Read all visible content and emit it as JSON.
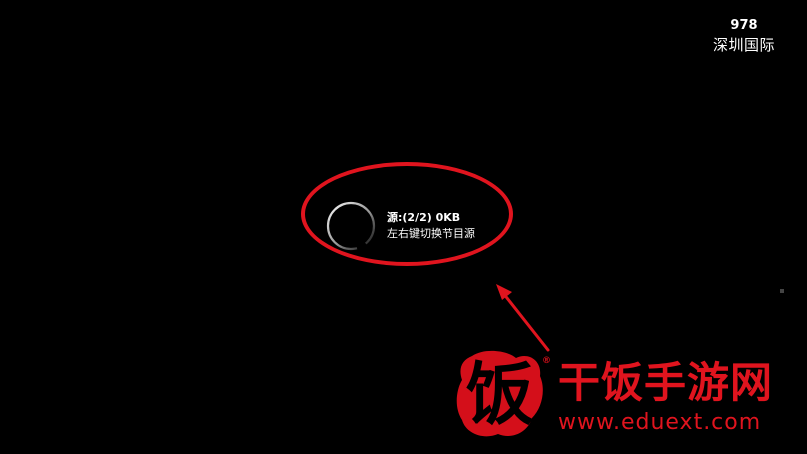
{
  "channel": {
    "number": "978",
    "name": "深圳国际"
  },
  "loading": {
    "source_status": "源:(2/2)  0KB",
    "hint": "左右键切换节目源",
    "spinner_icon": "loading-spinner-icon"
  },
  "watermark": {
    "logo_char": "饭",
    "registered_mark": "®",
    "site_name": "干饭手游网",
    "site_url": "www.eduext.com"
  },
  "colors": {
    "background": "#000000",
    "text": "#ffffff",
    "annotation_red": "#e0141e",
    "watermark_red": "#e0141e"
  }
}
